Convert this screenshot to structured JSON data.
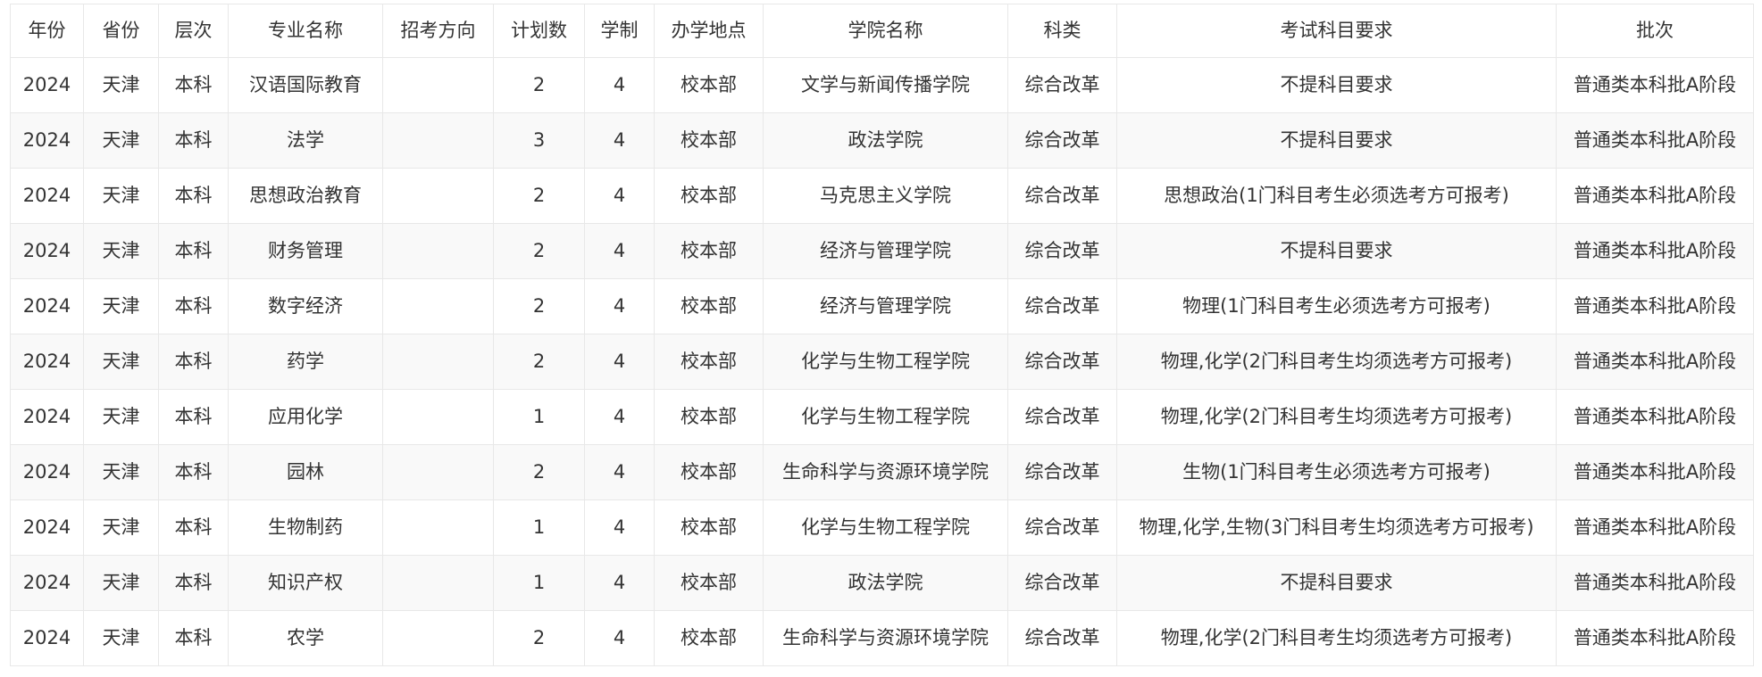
{
  "table": {
    "headers": [
      "年份",
      "省份",
      "层次",
      "专业名称",
      "招考方向",
      "计划数",
      "学制",
      "办学地点",
      "学院名称",
      "科类",
      "考试科目要求",
      "批次"
    ],
    "rows": [
      [
        "2024",
        "天津",
        "本科",
        "汉语国际教育",
        "",
        "2",
        "4",
        "校本部",
        "文学与新闻传播学院",
        "综合改革",
        "不提科目要求",
        "普通类本科批A阶段"
      ],
      [
        "2024",
        "天津",
        "本科",
        "法学",
        "",
        "3",
        "4",
        "校本部",
        "政法学院",
        "综合改革",
        "不提科目要求",
        "普通类本科批A阶段"
      ],
      [
        "2024",
        "天津",
        "本科",
        "思想政治教育",
        "",
        "2",
        "4",
        "校本部",
        "马克思主义学院",
        "综合改革",
        "思想政治(1门科目考生必须选考方可报考)",
        "普通类本科批A阶段"
      ],
      [
        "2024",
        "天津",
        "本科",
        "财务管理",
        "",
        "2",
        "4",
        "校本部",
        "经济与管理学院",
        "综合改革",
        "不提科目要求",
        "普通类本科批A阶段"
      ],
      [
        "2024",
        "天津",
        "本科",
        "数字经济",
        "",
        "2",
        "4",
        "校本部",
        "经济与管理学院",
        "综合改革",
        "物理(1门科目考生必须选考方可报考)",
        "普通类本科批A阶段"
      ],
      [
        "2024",
        "天津",
        "本科",
        "药学",
        "",
        "2",
        "4",
        "校本部",
        "化学与生物工程学院",
        "综合改革",
        "物理,化学(2门科目考生均须选考方可报考)",
        "普通类本科批A阶段"
      ],
      [
        "2024",
        "天津",
        "本科",
        "应用化学",
        "",
        "1",
        "4",
        "校本部",
        "化学与生物工程学院",
        "综合改革",
        "物理,化学(2门科目考生均须选考方可报考)",
        "普通类本科批A阶段"
      ],
      [
        "2024",
        "天津",
        "本科",
        "园林",
        "",
        "2",
        "4",
        "校本部",
        "生命科学与资源环境学院",
        "综合改革",
        "生物(1门科目考生必须选考方可报考)",
        "普通类本科批A阶段"
      ],
      [
        "2024",
        "天津",
        "本科",
        "生物制药",
        "",
        "1",
        "4",
        "校本部",
        "化学与生物工程学院",
        "综合改革",
        "物理,化学,生物(3门科目考生均须选考方可报考)",
        "普通类本科批A阶段"
      ],
      [
        "2024",
        "天津",
        "本科",
        "知识产权",
        "",
        "1",
        "4",
        "校本部",
        "政法学院",
        "综合改革",
        "不提科目要求",
        "普通类本科批A阶段"
      ],
      [
        "2024",
        "天津",
        "本科",
        "农学",
        "",
        "2",
        "4",
        "校本部",
        "生命科学与资源环境学院",
        "综合改革",
        "物理,化学(2门科目考生均须选考方可报考)",
        "普通类本科批A阶段"
      ]
    ]
  }
}
